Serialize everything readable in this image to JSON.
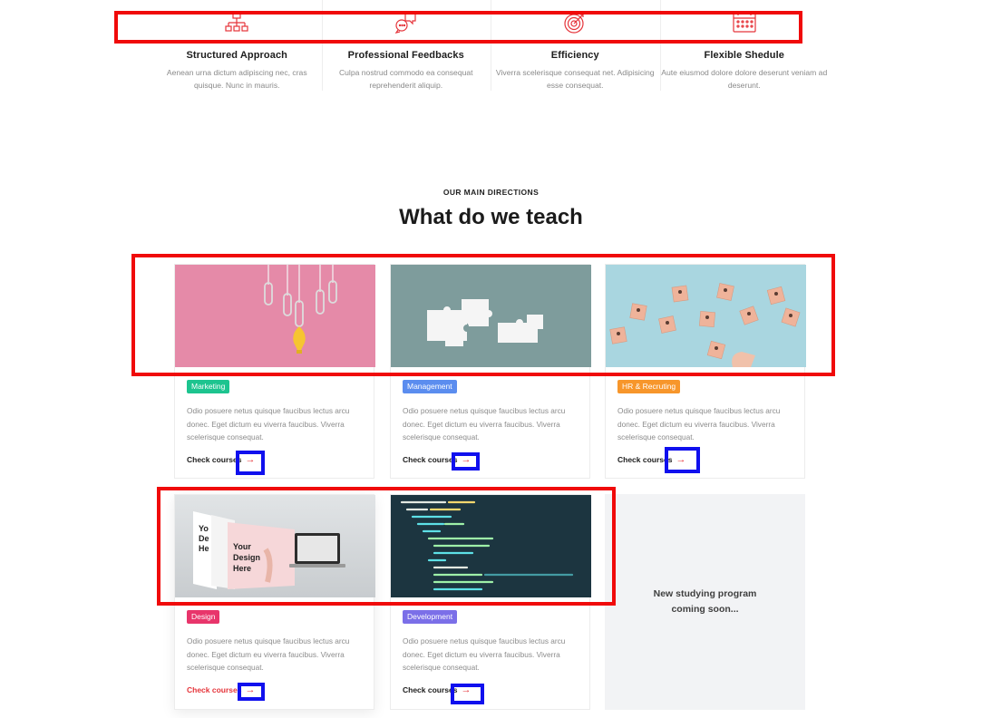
{
  "features": [
    {
      "icon": "sitemap-icon",
      "title": "Structured Approach",
      "text": "Aenean urna dictum adipiscing nec, cras quisque. Nunc in mauris."
    },
    {
      "icon": "chat-bubbles-icon",
      "title": "Professional Feedbacks",
      "text": "Culpa nostrud commodo ea consequat reprehenderit aliquip."
    },
    {
      "icon": "target-icon",
      "title": "Efficiency",
      "text": "Viverra scelerisque consequat net. Adipisicing esse consequat."
    },
    {
      "icon": "calendar-icon",
      "title": "Flexible Shedule",
      "text": "Aute eiusmod dolore dolore deserunt veniam ad deserunt."
    }
  ],
  "section": {
    "eyebrow": "OUR MAIN DIRECTIONS",
    "title": "What do we teach"
  },
  "cards": [
    {
      "tag": "Marketing",
      "tag_color": "#1dc48f",
      "image": "paperclip-lightbulb-image",
      "desc": "Odio posuere netus quisque faucibus lectus arcu donec. Eget dictum eu viverra faucibus. Viverra scelerisque consequat.",
      "link": "Check courses"
    },
    {
      "tag": "Management",
      "tag_color": "#5b8def",
      "image": "puzzle-pieces-image",
      "desc": "Odio posuere netus quisque faucibus lectus arcu donec. Eget dictum eu viverra faucibus. Viverra scelerisque consequat.",
      "link": "Check courses"
    },
    {
      "tag": "HR & Recruting",
      "tag_color": "#f7962b",
      "image": "people-cubes-image",
      "desc": "Odio posuere netus quisque faucibus lectus arcu donec. Eget dictum eu viverra faucibus. Viverra scelerisque consequat.",
      "link": "Check courses"
    },
    {
      "tag": "Design",
      "tag_color": "#e8356b",
      "image": "design-mockup-image",
      "desc": "Odio posuere netus quisque faucibus lectus arcu donec. Eget dictum eu viverra faucibus. Viverra scelerisque consequat.",
      "link": "Check courses",
      "mockup_text": [
        "Your",
        "Design",
        "Here"
      ],
      "mockup_text_behind": [
        "Yo",
        "De",
        "He"
      ]
    },
    {
      "tag": "Development",
      "tag_color": "#7b6fe8",
      "image": "code-screen-image",
      "desc": "Odio posuere netus quisque faucibus lectus arcu donec. Eget dictum eu viverra faucibus. Viverra scelerisque consequat.",
      "link": "Check courses"
    }
  ],
  "coming_soon": "New studying program coming soon...",
  "arrow_glyph": "→",
  "colors": {
    "accent": "#e5343a",
    "annotation_red": "#f00a0a",
    "annotation_blue": "#1010ee"
  }
}
